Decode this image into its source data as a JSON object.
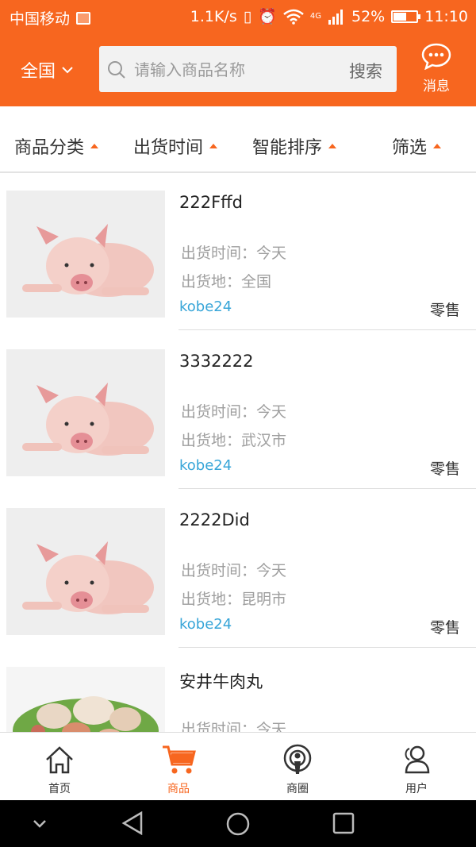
{
  "status": {
    "carrier": "中国移动",
    "speed": "1.1K/s",
    "network": "4G",
    "battery": "52%",
    "time": "11:10"
  },
  "header": {
    "region": "全国",
    "search_placeholder": "请输入商品名称",
    "search_button": "搜索",
    "message_label": "消息"
  },
  "filters": [
    "商品分类",
    "出货时间",
    "智能排序",
    "筛选"
  ],
  "products": [
    {
      "title": "222Fffd",
      "time": "出货时间：今天",
      "place": "出货地：全国",
      "seller": "kobe24",
      "mode": "零售",
      "image": "pig"
    },
    {
      "title": "3332222",
      "time": "出货时间：今天",
      "place": "出货地：武汉市",
      "seller": "kobe24",
      "mode": "零售",
      "image": "pig"
    },
    {
      "title": "2222Did",
      "time": "出货时间：今天",
      "place": "出货地：昆明市",
      "seller": "kobe24",
      "mode": "零售",
      "image": "pig"
    },
    {
      "title": "安井牛肉丸",
      "time": "出货时间：今天",
      "place": "",
      "seller": "",
      "mode": "",
      "image": "meatballs"
    }
  ],
  "tabs": [
    "首页",
    "商品",
    "商圈",
    "用户"
  ],
  "colors": {
    "accent": "#f7661f",
    "seller": "#37a5d8"
  }
}
